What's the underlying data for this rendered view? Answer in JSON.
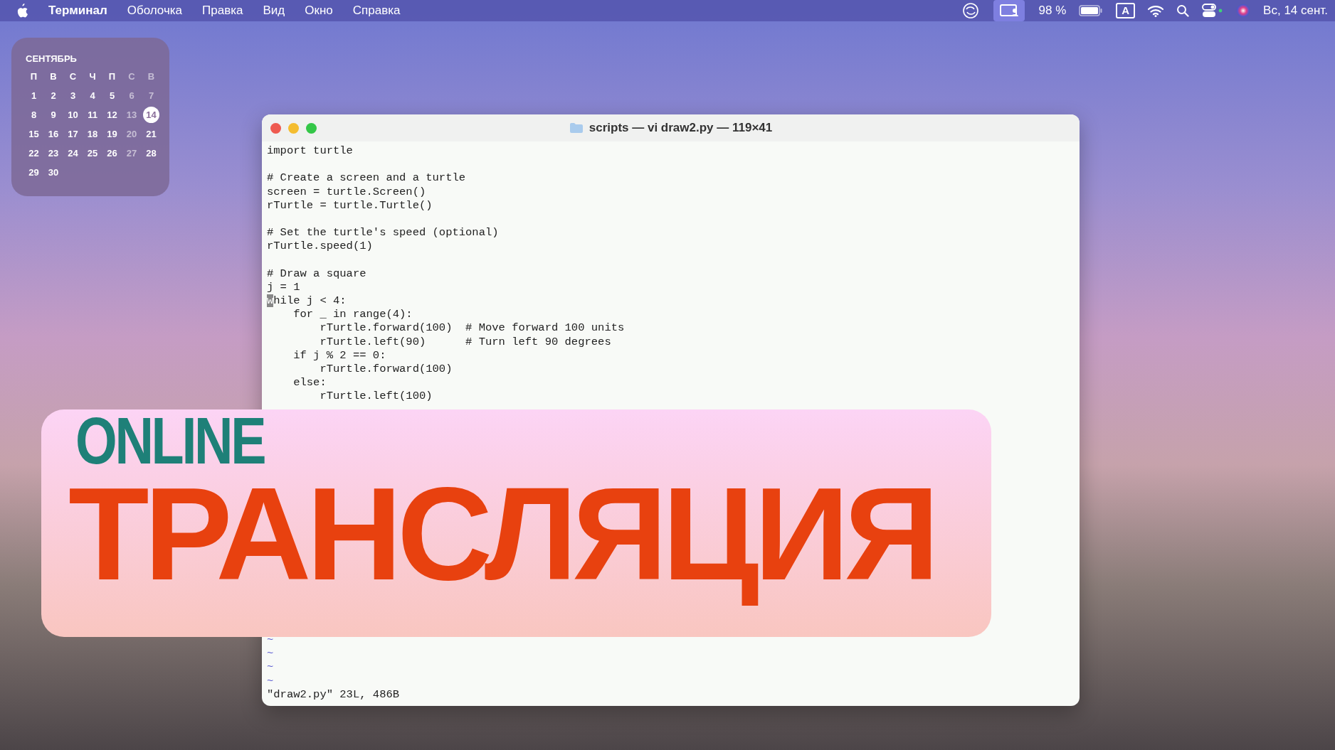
{
  "menu_bar": {
    "app_name": "Терминал",
    "menus": [
      "Оболочка",
      "Правка",
      "Вид",
      "Окно",
      "Справка"
    ],
    "battery_text": "98 %",
    "keyboard_layout": "A",
    "clock": "Вс, 14 сент."
  },
  "calendar_widget": {
    "month": "СЕНТЯБРЬ",
    "weekdays": [
      {
        "label": "П",
        "dimmed": false
      },
      {
        "label": "В",
        "dimmed": false
      },
      {
        "label": "С",
        "dimmed": false
      },
      {
        "label": "Ч",
        "dimmed": false
      },
      {
        "label": "П",
        "dimmed": false
      },
      {
        "label": "С",
        "dimmed": true
      },
      {
        "label": "В",
        "dimmed": true
      }
    ],
    "weeks": [
      [
        {
          "day": "1",
          "dimmed": false,
          "selected": false
        },
        {
          "day": "2",
          "dimmed": false,
          "selected": false
        },
        {
          "day": "3",
          "dimmed": false,
          "selected": false
        },
        {
          "day": "4",
          "dimmed": false,
          "selected": false
        },
        {
          "day": "5",
          "dimmed": false,
          "selected": false
        },
        {
          "day": "6",
          "dimmed": true,
          "selected": false
        },
        {
          "day": "7",
          "dimmed": true,
          "selected": false
        }
      ],
      [
        {
          "day": "8",
          "dimmed": false,
          "selected": false
        },
        {
          "day": "9",
          "dimmed": false,
          "selected": false
        },
        {
          "day": "10",
          "dimmed": false,
          "selected": false
        },
        {
          "day": "11",
          "dimmed": false,
          "selected": false
        },
        {
          "day": "12",
          "dimmed": false,
          "selected": false
        },
        {
          "day": "13",
          "dimmed": true,
          "selected": false
        },
        {
          "day": "14",
          "dimmed": false,
          "selected": true
        }
      ],
      [
        {
          "day": "15",
          "dimmed": false,
          "selected": false
        },
        {
          "day": "16",
          "dimmed": false,
          "selected": false
        },
        {
          "day": "17",
          "dimmed": false,
          "selected": false
        },
        {
          "day": "18",
          "dimmed": false,
          "selected": false
        },
        {
          "day": "19",
          "dimmed": false,
          "selected": false
        },
        {
          "day": "20",
          "dimmed": true,
          "selected": false
        },
        {
          "day": "21",
          "dimmed": false,
          "selected": false
        }
      ],
      [
        {
          "day": "22",
          "dimmed": false,
          "selected": false
        },
        {
          "day": "23",
          "dimmed": false,
          "selected": false
        },
        {
          "day": "24",
          "dimmed": false,
          "selected": false
        },
        {
          "day": "25",
          "dimmed": false,
          "selected": false
        },
        {
          "day": "26",
          "dimmed": false,
          "selected": false
        },
        {
          "day": "27",
          "dimmed": true,
          "selected": false
        },
        {
          "day": "28",
          "dimmed": false,
          "selected": false
        }
      ],
      [
        {
          "day": "29",
          "dimmed": false,
          "selected": false
        },
        {
          "day": "30",
          "dimmed": false,
          "selected": false
        }
      ]
    ]
  },
  "terminal_window": {
    "title": "scripts — vi draw2.py — 119×41",
    "code_blocks": [
      [
        {
          "text": "import turtle"
        }
      ],
      [
        {
          "text": "# Create a screen and a turtle"
        },
        {
          "text": "screen = turtle.Screen()"
        },
        {
          "text": "rTurtle = turtle.Turtle()"
        }
      ],
      [
        {
          "text": "# Set the turtle's speed (optional)"
        },
        {
          "text": "rTurtle.speed(1)"
        }
      ],
      [
        {
          "text": "# Draw a square"
        },
        {
          "text": "j = 1"
        },
        {
          "text": "while j < 4:",
          "cursor": true
        },
        {
          "text": "    for _ in range(4):"
        },
        {
          "text": "        rTurtle.forward(100)  # Move forward 100 units"
        },
        {
          "text": "        rTurtle.left(90)      # Turn left 90 degrees"
        },
        {
          "text": "    if j % 2 == 0:"
        },
        {
          "text": "        rTurtle.forward(100)"
        },
        {
          "text": "    else:"
        },
        {
          "text": "        rTurtle.left(100)"
        }
      ]
    ],
    "empty_line_markers": [
      "~",
      "~",
      "~",
      "~"
    ],
    "status_line": "\"draw2.py\" 23L, 486B"
  },
  "banner": {
    "line_1": "ONLINE",
    "line_2": "ТРАНСЛЯЦИЯ"
  }
}
